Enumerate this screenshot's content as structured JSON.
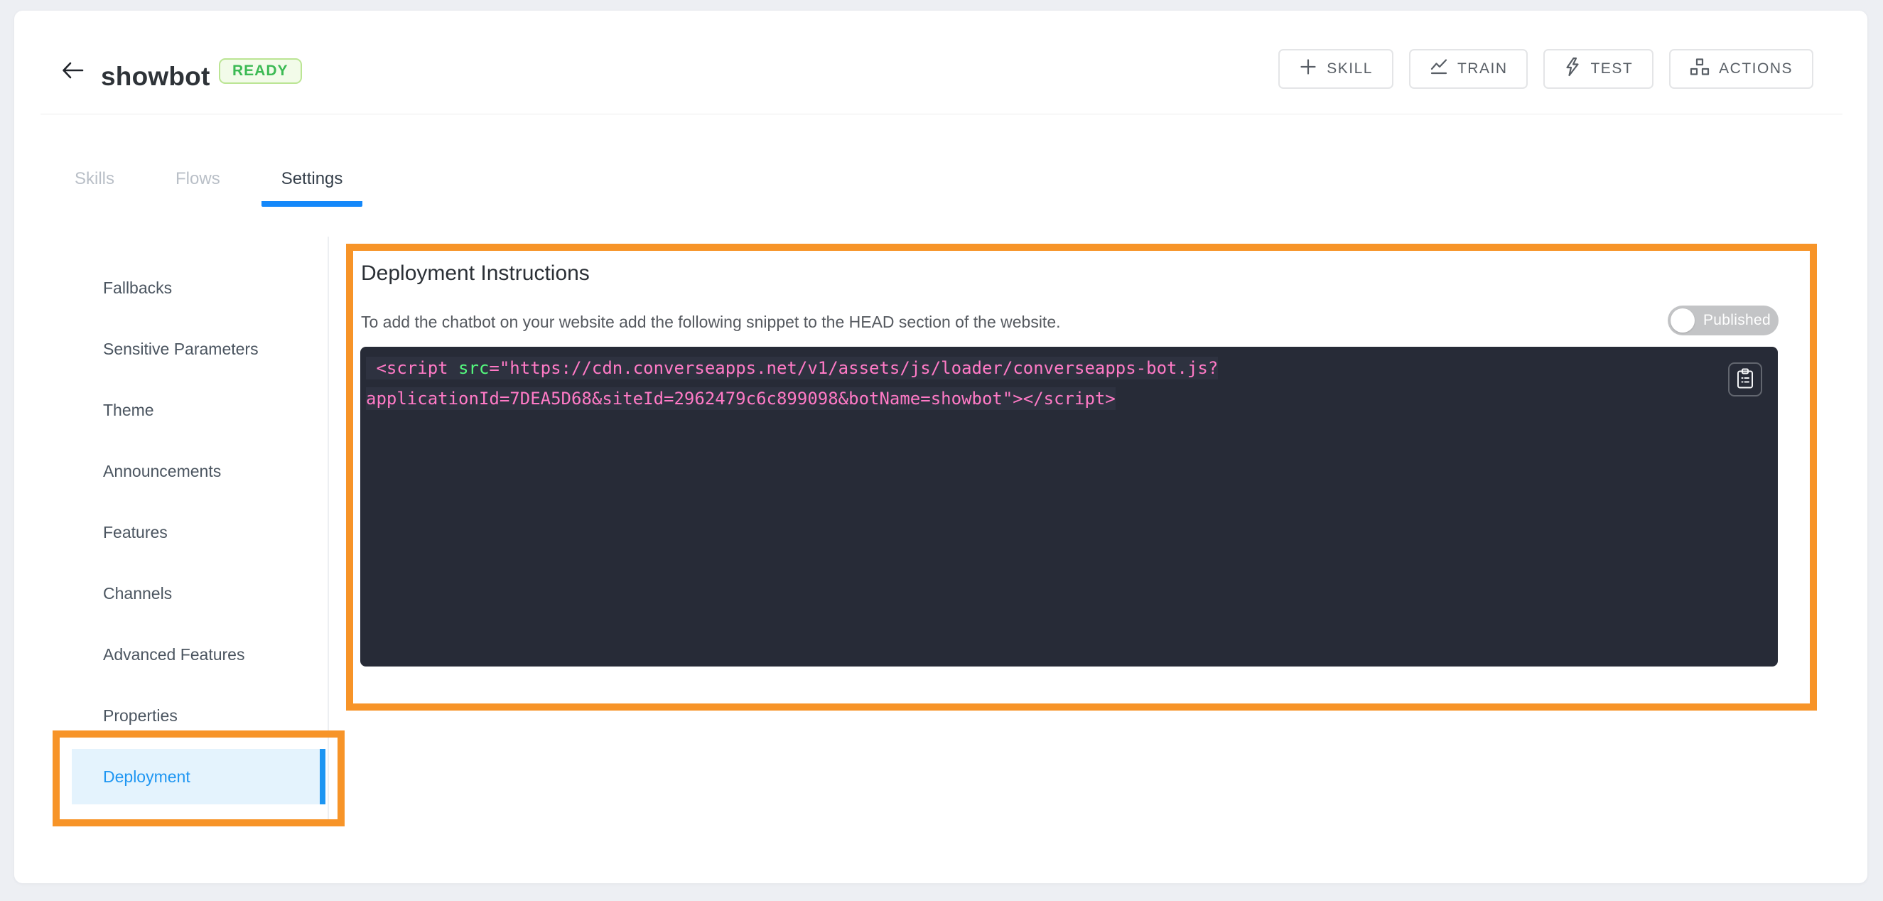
{
  "header": {
    "title": "showbot",
    "status_badge": "READY",
    "back_icon": "arrow-left-icon",
    "actions": [
      {
        "label": "SKILL",
        "icon": "plus-icon"
      },
      {
        "label": "TRAIN",
        "icon": "trend-line-icon"
      },
      {
        "label": "TEST",
        "icon": "lightning-icon"
      },
      {
        "label": "ACTIONS",
        "icon": "sitemap-icon"
      }
    ]
  },
  "tabs": [
    {
      "label": "Skills",
      "active": false
    },
    {
      "label": "Flows",
      "active": false
    },
    {
      "label": "Settings",
      "active": true
    }
  ],
  "sidebar": {
    "items": [
      {
        "label": "Fallbacks",
        "active": false
      },
      {
        "label": "Sensitive Parameters",
        "active": false
      },
      {
        "label": "Theme",
        "active": false
      },
      {
        "label": "Announcements",
        "active": false
      },
      {
        "label": "Features",
        "active": false
      },
      {
        "label": "Channels",
        "active": false
      },
      {
        "label": "Advanced Features",
        "active": false
      },
      {
        "label": "Properties",
        "active": false
      },
      {
        "label": "Deployment",
        "active": true
      }
    ]
  },
  "main": {
    "heading": "Deployment Instructions",
    "description": "To add the chatbot on your website add the following snippet to the HEAD section of the website.",
    "publish_toggle": {
      "label": "Published",
      "state": "off"
    },
    "copy_icon": "clipboard-icon",
    "code": {
      "lines": [
        {
          "parts": [
            {
              "text": " <script ",
              "color": "pink"
            },
            {
              "text": "src",
              "color": "green"
            },
            {
              "text": "=\"https://cdn.converseapps.net/v1/assets/js/loader/converseapps-bot.js?",
              "color": "pink"
            }
          ]
        },
        {
          "parts": [
            {
              "text": "applicationId=7DEA5D68&siteId=2962479c6c899098&botName=showbot\"></script>",
              "color": "pink"
            }
          ]
        }
      ]
    }
  },
  "colors": {
    "accent_blue": "#1e96f2",
    "tab_underline_blue": "#1488fa",
    "annotation_orange": "#f79428",
    "status_green": "#3cba54",
    "code_background": "#272b37",
    "code_pink": "#ff7ac6",
    "code_green": "#54fa7e",
    "toggle_gray": "#c3c4c6"
  }
}
